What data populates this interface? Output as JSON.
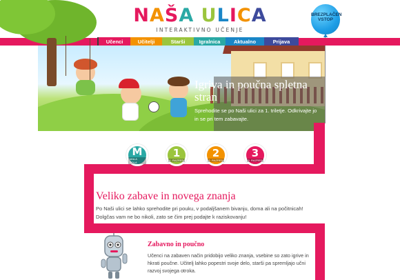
{
  "header": {
    "logo_title": "NAŠA ULICA",
    "logo_subtitle": "INTERAKTIVNO UČENJE",
    "balloon_label": "BREZPLAČEN VSTOP",
    "logo_letter_colors": [
      "#e5195e",
      "#f39200",
      "#e5195e",
      "#2aa9a5",
      "#ffffff",
      "#9bc53d",
      "#1a86c7",
      "#e5195e",
      "#f39200",
      "#3d4a9c"
    ]
  },
  "nav": {
    "items": [
      {
        "label": "Učenci",
        "color": "#e5195e"
      },
      {
        "label": "Učitelji",
        "color": "#f39200"
      },
      {
        "label": "Starši",
        "color": "#9bc53d"
      },
      {
        "label": "Igralnica",
        "color": "#2aa9a5"
      },
      {
        "label": "Aktualno",
        "color": "#1a86c7"
      },
      {
        "label": "Prijava",
        "color": "#3d4a9c"
      }
    ]
  },
  "hero": {
    "title": "Igriva in poučna spletna stran",
    "text": "Sprehodite se po Naši ulici za 1. triletje. Odkrivajte jo in se pri tem zabavajte."
  },
  "levels": [
    {
      "main": "M",
      "sub": "MALA ŠOLA",
      "color": "#2aa9a5"
    },
    {
      "main": "1",
      "sub": "1. RAZRED",
      "color": "#9bc53d"
    },
    {
      "main": "2",
      "sub": "2. RAZRED",
      "color": "#f39200"
    },
    {
      "main": "3",
      "sub": "3. RAZRED",
      "color": "#e5195e"
    }
  ],
  "section": {
    "title": "Veliko zabave in novega znanja",
    "text": "Po Naši ulici se lahko sprehodite pri pouku, v podaljšanem bivanju, doma ali na počitnicah! Dolgčas vam ne bo nikoli, zato se čim prej podajte k raziskovanju!"
  },
  "feature": {
    "title": "Zabavno in poučno",
    "text": "Učenci na zabaven način pridobijo veliko znanja, vsebine so zato igrive in hkrati poučne. Učitelj lahko popestri svoje delo, starši pa spremljajo učni razvoj svojega otroka.",
    "icon": "robot-mascot-icon"
  },
  "colors": {
    "accent": "#e5195e",
    "path": "#e5195e"
  }
}
